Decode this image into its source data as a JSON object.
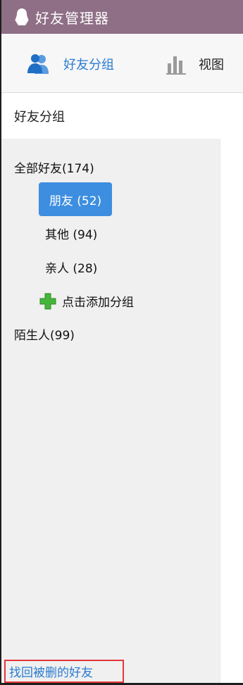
{
  "window": {
    "title": "好友管理器",
    "icon": "qq-penguin-icon"
  },
  "toolbar": {
    "groups_label": "好友分组",
    "groups_icon": "users-icon",
    "view_label": "视图",
    "view_icon": "bar-chart-icon"
  },
  "sidebar": {
    "section_title": "好友分组",
    "tree": {
      "all_label": "全部好友(174)",
      "children": [
        {
          "label": "朋友 (52)",
          "selected": true
        },
        {
          "label": "其他 (94)"
        },
        {
          "label": "亲人 (28)"
        }
      ],
      "add_group_label": "点击添加分组",
      "add_group_icon": "green-plus-icon",
      "strangers_label": "陌生人(99)"
    },
    "recover_link": "找回被删的好友"
  },
  "colors": {
    "titlebar": "#8e6f86",
    "accent": "#2a7bd1",
    "selected": "#3d8ee0",
    "panel": "#f0f0f0",
    "highlight_border": "#e3363a",
    "add_icon": "#46b53a"
  }
}
